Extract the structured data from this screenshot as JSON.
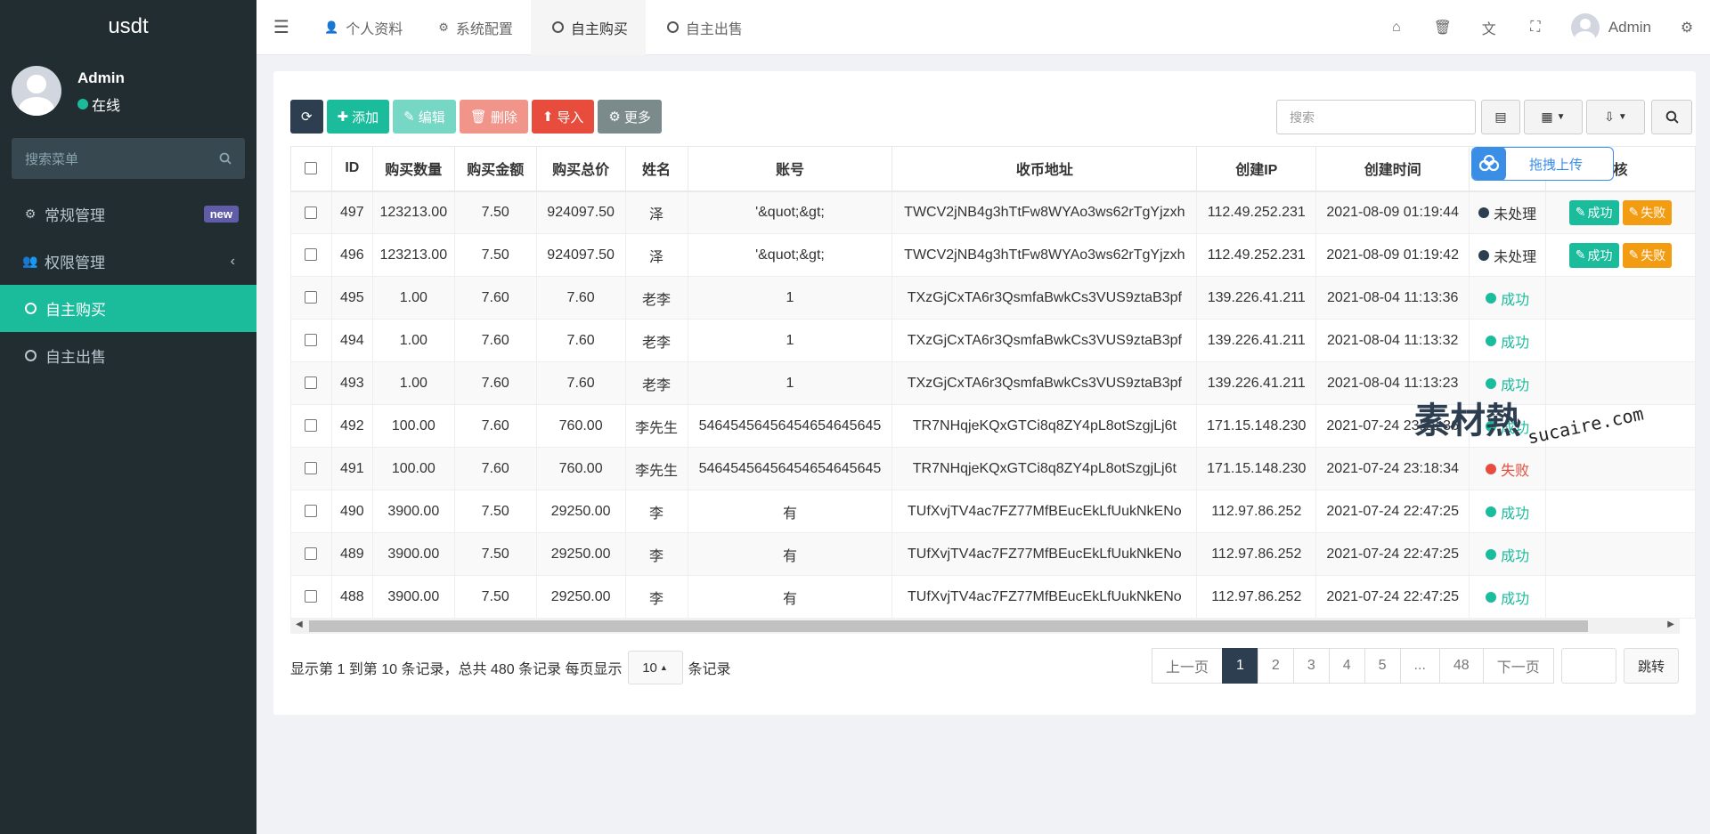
{
  "sidebar": {
    "logo": "usdt",
    "user_name": "Admin",
    "user_status": "在线",
    "search_placeholder": "搜索菜单",
    "items": [
      {
        "label": "常规管理",
        "badge": "new"
      },
      {
        "label": "权限管理"
      },
      {
        "label": "自主购买"
      },
      {
        "label": "自主出售"
      }
    ]
  },
  "topbar": {
    "tabs": [
      {
        "label": "个人资料"
      },
      {
        "label": "系统配置"
      },
      {
        "label": "自主购买"
      },
      {
        "label": "自主出售"
      }
    ],
    "user_name": "Admin"
  },
  "toolbar": {
    "add": "添加",
    "edit": "编辑",
    "delete": "删除",
    "import": "导入",
    "more": "更多",
    "search_placeholder": "搜索"
  },
  "table": {
    "headers": [
      "ID",
      "购买数量",
      "购买金额",
      "购买总价",
      "姓名",
      "账号",
      "收币地址",
      "创建IP",
      "创建时间",
      "",
      "核"
    ],
    "rows": [
      {
        "id": "497",
        "qty": "123213.00",
        "price": "7.50",
        "total": "924097.50",
        "name": "泽",
        "account": "'&quot;&gt;",
        "address": "TWCV2jNB4g3hTtFw8WYAo3ws62rTgYjzxh",
        "ip": "112.49.252.231",
        "time": "2021-08-09 01:19:44",
        "status": "未处理"
      },
      {
        "id": "496",
        "qty": "123213.00",
        "price": "7.50",
        "total": "924097.50",
        "name": "泽",
        "account": "'&quot;&gt;",
        "address": "TWCV2jNB4g3hTtFw8WYAo3ws62rTgYjzxh",
        "ip": "112.49.252.231",
        "time": "2021-08-09 01:19:42",
        "status": "未处理"
      },
      {
        "id": "495",
        "qty": "1.00",
        "price": "7.60",
        "total": "7.60",
        "name": "老李",
        "account": "1",
        "address": "TXzGjCxTA6r3QsmfaBwkCs3VUS9ztaB3pf",
        "ip": "139.226.41.211",
        "time": "2021-08-04 11:13:36",
        "status": "成功"
      },
      {
        "id": "494",
        "qty": "1.00",
        "price": "7.60",
        "total": "7.60",
        "name": "老李",
        "account": "1",
        "address": "TXzGjCxTA6r3QsmfaBwkCs3VUS9ztaB3pf",
        "ip": "139.226.41.211",
        "time": "2021-08-04 11:13:32",
        "status": "成功"
      },
      {
        "id": "493",
        "qty": "1.00",
        "price": "7.60",
        "total": "7.60",
        "name": "老李",
        "account": "1",
        "address": "TXzGjCxTA6r3QsmfaBwkCs3VUS9ztaB3pf",
        "ip": "139.226.41.211",
        "time": "2021-08-04 11:13:23",
        "status": "成功"
      },
      {
        "id": "492",
        "qty": "100.00",
        "price": "7.60",
        "total": "760.00",
        "name": "李先生",
        "account": "54645456456454654645645",
        "address": "TR7NHqjeKQxGTCi8q8ZY4pL8otSzgjLj6t",
        "ip": "171.15.148.230",
        "time": "2021-07-24 23:18:36",
        "status": "成功"
      },
      {
        "id": "491",
        "qty": "100.00",
        "price": "7.60",
        "total": "760.00",
        "name": "李先生",
        "account": "54645456456454654645645",
        "address": "TR7NHqjeKQxGTCi8q8ZY4pL8otSzgjLj6t",
        "ip": "171.15.148.230",
        "time": "2021-07-24 23:18:34",
        "status": "失败"
      },
      {
        "id": "490",
        "qty": "3900.00",
        "price": "7.50",
        "total": "29250.00",
        "name": "李",
        "account": "有",
        "address": "TUfXvjTV4ac7FZ77MfBEucEkLfUukNkENo",
        "ip": "112.97.86.252",
        "time": "2021-07-24 22:47:25",
        "status": "成功"
      },
      {
        "id": "489",
        "qty": "3900.00",
        "price": "7.50",
        "total": "29250.00",
        "name": "李",
        "account": "有",
        "address": "TUfXvjTV4ac7FZ77MfBEucEkLfUukNkENo",
        "ip": "112.97.86.252",
        "time": "2021-07-24 22:47:25",
        "status": "成功"
      },
      {
        "id": "488",
        "qty": "3900.00",
        "price": "7.50",
        "total": "29250.00",
        "name": "李",
        "account": "有",
        "address": "TUfXvjTV4ac7FZ77MfBEucEkLfUukNkENo",
        "ip": "112.97.86.252",
        "time": "2021-07-24 22:47:25",
        "status": "成功"
      }
    ],
    "op_success": "成功",
    "op_fail": "失败"
  },
  "pager": {
    "info_prefix": "显示第 1 到第 10 条记录，总共 480 条记录 每页显示",
    "page_size": "10",
    "info_suffix": "条记录",
    "prev": "上一页",
    "pages": [
      "1",
      "2",
      "3",
      "4",
      "5",
      "...",
      "48"
    ],
    "next": "下一页",
    "jump": "跳转"
  },
  "overlay": {
    "upload_label": "拖拽上传",
    "watermark_cn": "素材熱",
    "watermark_en": "sucaire.com"
  }
}
